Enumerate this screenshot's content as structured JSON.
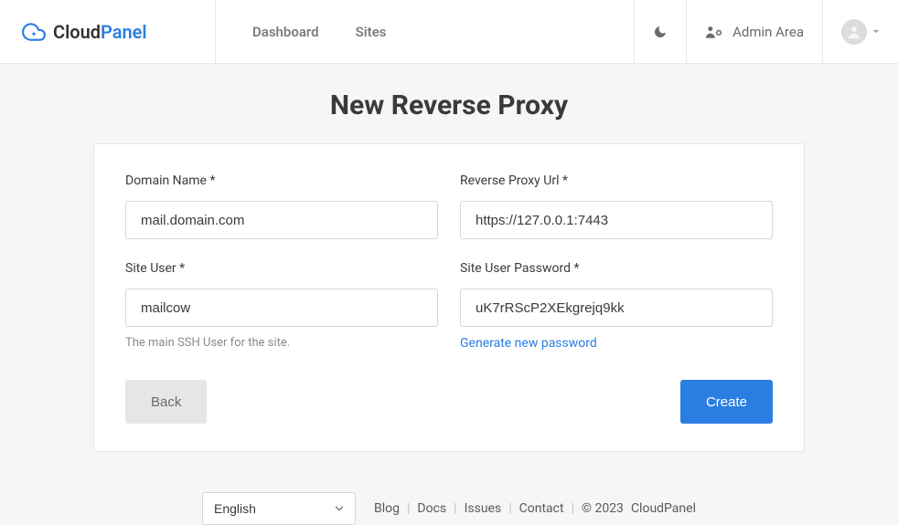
{
  "header": {
    "logo_cloud": "Cloud",
    "logo_panel": "Panel",
    "nav": {
      "dashboard": "Dashboard",
      "sites": "Sites"
    },
    "admin_area_label": "Admin Area"
  },
  "page": {
    "title": "New Reverse Proxy"
  },
  "form": {
    "domain_name": {
      "label": "Domain Name *",
      "value": "mail.domain.com"
    },
    "reverse_proxy_url": {
      "label": "Reverse Proxy Url *",
      "value": "https://127.0.0.1:7443"
    },
    "site_user": {
      "label": "Site User *",
      "value": "mailcow",
      "helper": "The main SSH User for the site."
    },
    "site_user_password": {
      "label": "Site User Password *",
      "value": "uK7rRScP2XEkgrejq9kk",
      "generate_link": "Generate new password"
    },
    "buttons": {
      "back": "Back",
      "create": "Create"
    }
  },
  "footer": {
    "language": "English",
    "links": {
      "blog": "Blog",
      "docs": "Docs",
      "issues": "Issues",
      "contact": "Contact"
    },
    "copyright": "© 2023",
    "brand": "CloudPanel"
  }
}
